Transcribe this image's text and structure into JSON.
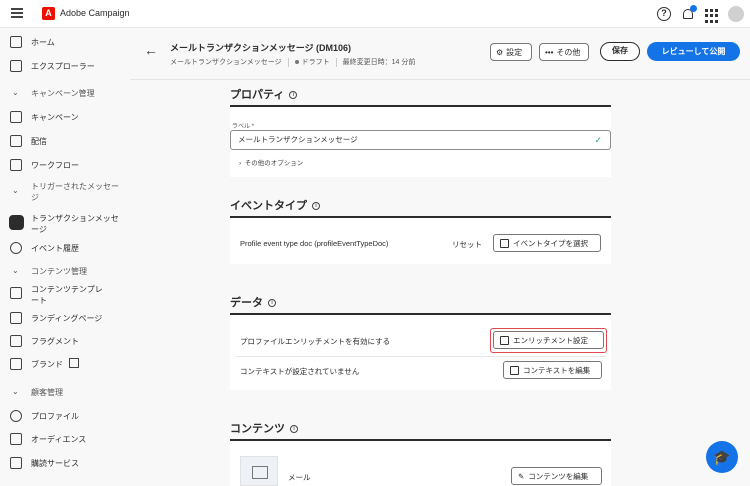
{
  "app": {
    "title": "Adobe Campaign"
  },
  "sidebar": {
    "items": [
      {
        "label": "ホーム"
      },
      {
        "label": "エクスプローラー"
      },
      {
        "label": "キャンペーン管理"
      },
      {
        "label": "キャンペーン"
      },
      {
        "label": "配信"
      },
      {
        "label": "ワークフロー"
      },
      {
        "label": "トリガーされたメッセージ"
      },
      {
        "label": "トランザクションメッセージ"
      },
      {
        "label": "イベント履歴"
      },
      {
        "label": "コンテンツ管理"
      },
      {
        "label": "コンテンツテンプレート"
      },
      {
        "label": "ランディングページ"
      },
      {
        "label": "フラグメント"
      },
      {
        "label": "ブランド"
      },
      {
        "label": "顧客管理"
      },
      {
        "label": "プロファイル"
      },
      {
        "label": "オーディエンス"
      },
      {
        "label": "購読サービス"
      }
    ]
  },
  "header": {
    "title": "メールトランザクションメッセージ (DM106)",
    "subtitle": "メールトランザクションメッセージ",
    "status": "ドラフト",
    "last_modified": "最終変更日時：14 分前",
    "settings_label": "設定",
    "more_label": "その他",
    "save_label": "保存",
    "publish_label": "レビューして公開"
  },
  "properties": {
    "title": "プロパティ",
    "label_caption": "ラベル",
    "required_mark": "*",
    "label_value": "メールトランザクションメッセージ",
    "more_options": "その他のオプション"
  },
  "event_type": {
    "title": "イベントタイプ",
    "doc_text": "Profile event type doc (profileEventTypeDoc)",
    "reset_label": "リセット",
    "select_label": "イベントタイプを選択"
  },
  "data": {
    "title": "データ",
    "enrichment_text": "プロファイルエンリッチメントを有効にする",
    "enrichment_button": "エンリッチメント設定",
    "context_text": "コンテキストが設定されていません",
    "context_button": "コンテキストを編集"
  },
  "content": {
    "title": "コンテンツ",
    "mail_label": "メール",
    "edit_button": "コンテンツを編集"
  },
  "colors": {
    "accent": "#1473e6",
    "brand": "#eb1000",
    "highlight": "#e34850",
    "valid": "#2d9d78"
  }
}
